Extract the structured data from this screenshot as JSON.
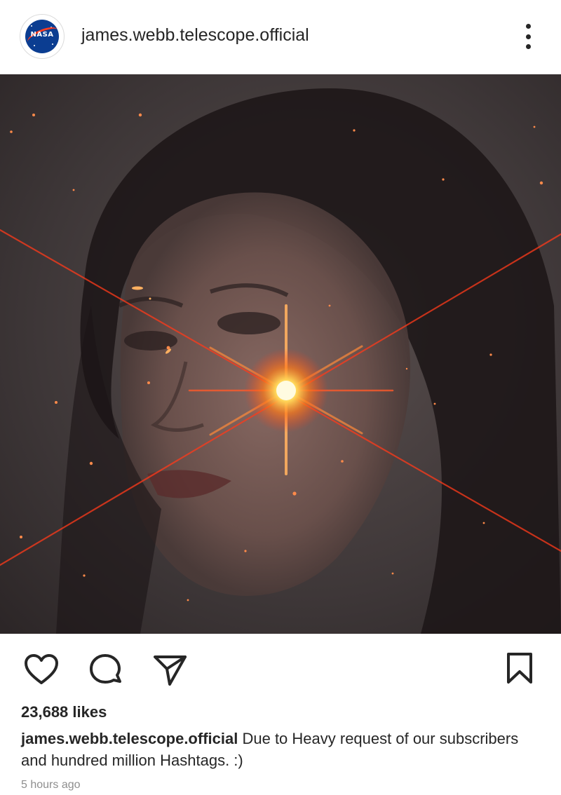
{
  "post": {
    "username": "james.webb.telescope.official",
    "avatar_text": "NASA",
    "likes": "23,688 likes",
    "caption_user": "james.webb.telescope.official",
    "caption_text": "Due to Heavy request of our subscribers and hundred million Hashtags. :)",
    "timestamp": "5 hours ago"
  },
  "icons": {
    "more": "more-options-icon",
    "like": "heart-icon",
    "comment": "comment-icon",
    "share": "send-icon",
    "save": "bookmark-icon"
  },
  "colors": {
    "text": "#262626",
    "muted": "#8e8e8e",
    "flare": "#ff3a1a",
    "flare_core": "#fff3b0",
    "nasa_blue": "#0b3d91",
    "nasa_red": "#fc3d21"
  }
}
